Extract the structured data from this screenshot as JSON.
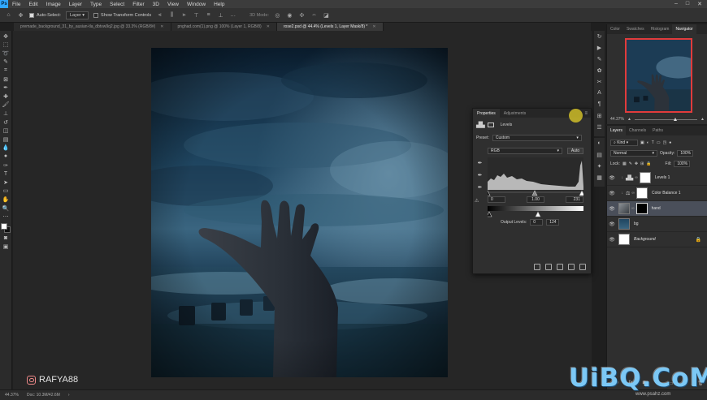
{
  "app": {
    "logo": "Ps",
    "menu": [
      "File",
      "Edit",
      "Image",
      "Layer",
      "Type",
      "Select",
      "Filter",
      "3D",
      "View",
      "Window",
      "Help"
    ],
    "window_controls": [
      "–",
      "□",
      "✕"
    ]
  },
  "options_bar": {
    "auto_select": "Auto-Select:",
    "layer_select": "Layer",
    "show_transform": "Show Transform Controls",
    "mode_3d": "3D Mode:"
  },
  "tabs": [
    {
      "label": "premade_background_31_by_ausian-tla_dbtvw9q2.jpg @ 33.3% (RGB/8#)",
      "active": false
    },
    {
      "label": "pnghad.com(1).png @ 100% (Layer 1, RGB/8)",
      "active": false
    },
    {
      "label": "rose2.psd @ 44.4% (Levels 1, Layer Mask/8) *",
      "active": true
    }
  ],
  "properties": {
    "tabs": [
      "Properties",
      "Adjustments"
    ],
    "type_label": "Levels",
    "preset_label": "Preset:",
    "preset_value": "Custom",
    "channel": "RGB",
    "auto_button": "Auto",
    "input_black": "0",
    "input_gamma": "1.00",
    "input_white": "231",
    "output_label": "Output Levels:",
    "output_black": "0",
    "output_white": "124"
  },
  "navigator": {
    "tabs": [
      "Color",
      "Swatches",
      "Histogram",
      "Navigator"
    ],
    "zoom": "44.37%",
    "zoom_level": 0.62
  },
  "layers_panel": {
    "tabs": [
      "Layers",
      "Channels",
      "Paths"
    ],
    "kind_label": "Kind",
    "blend_mode": "Normal",
    "opacity_label": "Opacity:",
    "opacity_value": "100%",
    "lock_label": "Lock:",
    "fill_label": "Fill:",
    "fill_value": "100%",
    "layers": [
      {
        "name": "Levels 1",
        "selected": false,
        "thumb": "levels"
      },
      {
        "name": "Color Balance 1",
        "selected": false,
        "thumb": "balance"
      },
      {
        "name": "hand",
        "selected": true,
        "thumb": "hand"
      },
      {
        "name": "bg",
        "selected": false,
        "thumb": "sky"
      },
      {
        "name": "Background",
        "selected": false,
        "thumb": "white"
      }
    ]
  },
  "status": {
    "zoom": "44.37%",
    "doc": "Doc: 10.3M/42.6M"
  },
  "watermarks": {
    "instagram": "RAFYA88",
    "site": "UiBQ.CoM",
    "site_sub": "www.psahz.com"
  },
  "colors": {
    "accent": "#31a8ff",
    "selection": "#4a4f5a",
    "navigator_frame": "#e23b3b",
    "cursor_highlight": "#e6d228"
  }
}
